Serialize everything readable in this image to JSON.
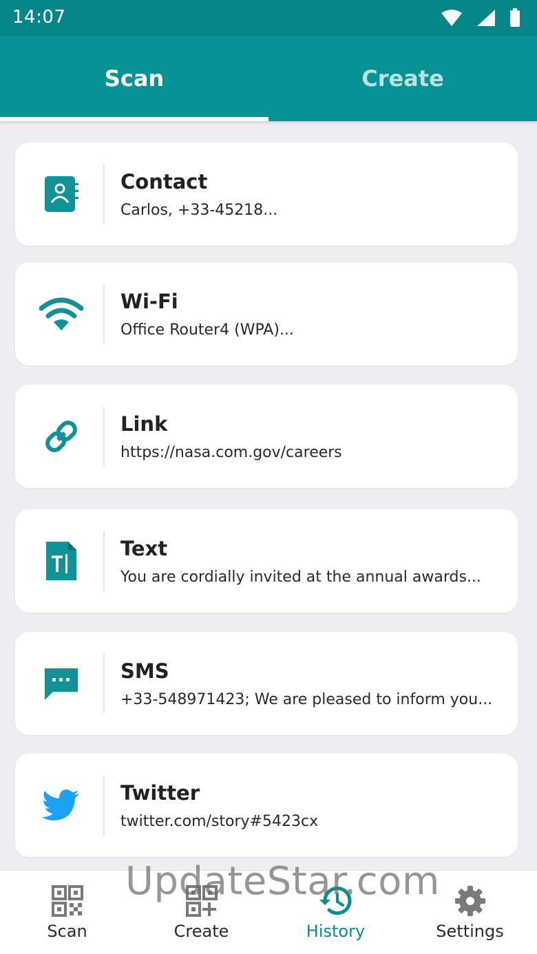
{
  "status_bar": {
    "time": "14:07"
  },
  "tabs": [
    {
      "label": "Scan",
      "active": true
    },
    {
      "label": "Create",
      "active": false
    }
  ],
  "history": [
    {
      "icon": "contact-book-icon",
      "title": "Contact",
      "subtitle": "Carlos, +33-45218..."
    },
    {
      "icon": "wifi-icon",
      "title": "Wi-Fi",
      "subtitle": "Office Router4 (WPA)..."
    },
    {
      "icon": "link-icon",
      "title": "Link",
      "subtitle": "https://nasa.com.gov/careers"
    },
    {
      "icon": "text-document-icon",
      "title": "Text",
      "subtitle": "You are cordially invited at the annual awards..."
    },
    {
      "icon": "sms-icon",
      "title": "SMS",
      "subtitle": "+33-548971423; We are pleased to inform you..."
    },
    {
      "icon": "twitter-icon",
      "title": "Twitter",
      "subtitle": "twitter.com/story#5423cx"
    }
  ],
  "bottom_nav": [
    {
      "icon": "qr-code-icon",
      "label": "Scan",
      "active": false
    },
    {
      "icon": "create-qr-icon",
      "label": "Create",
      "active": false
    },
    {
      "icon": "history-icon",
      "label": "History",
      "active": true
    },
    {
      "icon": "gear-icon",
      "label": "Settings",
      "active": false
    }
  ],
  "watermark": "UpdateStar.com",
  "colors": {
    "primary": "#079396",
    "status_bar": "#07868A",
    "twitter": "#1DA1F2",
    "background": "#EDEEF3"
  }
}
